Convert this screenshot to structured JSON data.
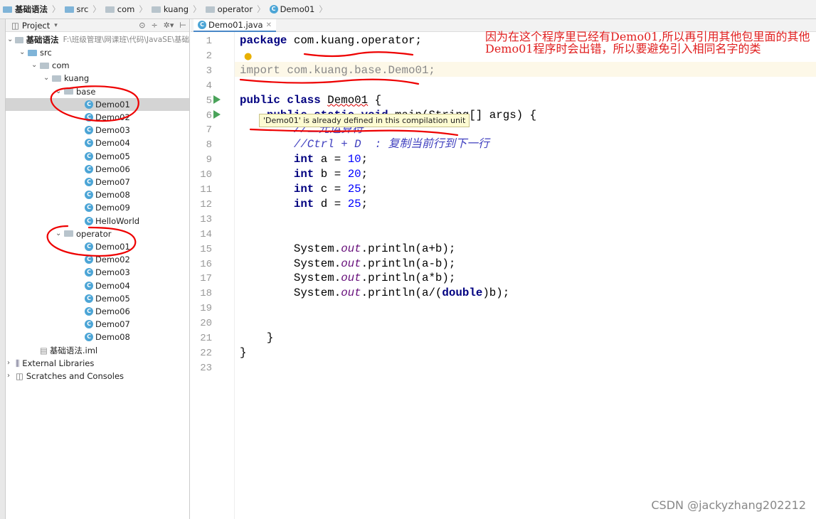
{
  "breadcrumb": [
    "基础语法",
    "src",
    "com",
    "kuang",
    "operator",
    "Demo01"
  ],
  "sidebar": {
    "title": "Project",
    "root": {
      "label": "基础语法",
      "path": "F:\\班级管理\\网课班\\代码\\JavaSE\\基础"
    },
    "tree": [
      {
        "label": "src",
        "depth": 1,
        "type": "folder-blue",
        "expanded": true
      },
      {
        "label": "com",
        "depth": 2,
        "type": "folder",
        "expanded": true
      },
      {
        "label": "kuang",
        "depth": 3,
        "type": "folder",
        "expanded": true
      },
      {
        "label": "base",
        "depth": 4,
        "type": "folder",
        "expanded": true
      },
      {
        "label": "Demo01",
        "depth": 5,
        "type": "class",
        "selected": true
      },
      {
        "label": "Demo02",
        "depth": 5,
        "type": "class"
      },
      {
        "label": "Demo03",
        "depth": 5,
        "type": "class"
      },
      {
        "label": "Demo04",
        "depth": 5,
        "type": "class"
      },
      {
        "label": "Demo05",
        "depth": 5,
        "type": "class"
      },
      {
        "label": "Demo06",
        "depth": 5,
        "type": "class"
      },
      {
        "label": "Demo07",
        "depth": 5,
        "type": "class"
      },
      {
        "label": "Demo08",
        "depth": 5,
        "type": "class"
      },
      {
        "label": "Demo09",
        "depth": 5,
        "type": "class"
      },
      {
        "label": "HelloWorld",
        "depth": 5,
        "type": "class"
      },
      {
        "label": "operator",
        "depth": 4,
        "type": "folder",
        "expanded": true
      },
      {
        "label": "Demo01",
        "depth": 5,
        "type": "class"
      },
      {
        "label": "Demo02",
        "depth": 5,
        "type": "class"
      },
      {
        "label": "Demo03",
        "depth": 5,
        "type": "class"
      },
      {
        "label": "Demo04",
        "depth": 5,
        "type": "class"
      },
      {
        "label": "Demo05",
        "depth": 5,
        "type": "class"
      },
      {
        "label": "Demo06",
        "depth": 5,
        "type": "class"
      },
      {
        "label": "Demo07",
        "depth": 5,
        "type": "class"
      },
      {
        "label": "Demo08",
        "depth": 5,
        "type": "class"
      },
      {
        "label": "基础语法.iml",
        "depth": 2,
        "type": "file"
      },
      {
        "label": "External Libraries",
        "depth": 0,
        "type": "lib",
        "expanded": false
      },
      {
        "label": "Scratches and Consoles",
        "depth": 0,
        "type": "scratch",
        "expanded": false
      }
    ]
  },
  "editor": {
    "tab": "Demo01.java",
    "current_line": 3,
    "lines": [
      [
        [
          "package",
          "kw"
        ],
        [
          " com.kuang.operator;",
          ""
        ]
      ],
      [],
      [
        [
          "import com.kuang.base.Demo01;",
          "unused"
        ]
      ],
      [],
      [
        [
          "public class",
          "kw"
        ],
        [
          " ",
          ""
        ],
        [
          "Demo01",
          "err"
        ],
        [
          " {",
          ""
        ]
      ],
      [
        [
          "    ",
          ""
        ],
        [
          "public static void",
          "kw"
        ],
        [
          " main(String[] args) {",
          ""
        ]
      ],
      [
        [
          "        //二元运算符",
          "cm"
        ]
      ],
      [
        [
          "        //Ctrl + D  : 复制当前行到下一行",
          "cm"
        ]
      ],
      [
        [
          "        ",
          ""
        ],
        [
          "int",
          "kw"
        ],
        [
          " a = ",
          ""
        ],
        [
          "10",
          "num"
        ],
        [
          ";",
          ""
        ]
      ],
      [
        [
          "        ",
          ""
        ],
        [
          "int",
          "kw"
        ],
        [
          " b = ",
          ""
        ],
        [
          "20",
          "num"
        ],
        [
          ";",
          ""
        ]
      ],
      [
        [
          "        ",
          ""
        ],
        [
          "int",
          "kw"
        ],
        [
          " c = ",
          ""
        ],
        [
          "25",
          "num"
        ],
        [
          ";",
          ""
        ]
      ],
      [
        [
          "        ",
          ""
        ],
        [
          "int",
          "kw"
        ],
        [
          " d = ",
          ""
        ],
        [
          "25",
          "num"
        ],
        [
          ";",
          ""
        ]
      ],
      [],
      [],
      [
        [
          "        System.",
          ""
        ],
        [
          "out",
          "fld"
        ],
        [
          ".println(a+b);",
          ""
        ]
      ],
      [
        [
          "        System.",
          ""
        ],
        [
          "out",
          "fld"
        ],
        [
          ".println(a-b);",
          ""
        ]
      ],
      [
        [
          "        System.",
          ""
        ],
        [
          "out",
          "fld"
        ],
        [
          ".println(a*b);",
          ""
        ]
      ],
      [
        [
          "        System.",
          ""
        ],
        [
          "out",
          "fld"
        ],
        [
          ".println(a/(",
          ""
        ],
        [
          "double",
          "kw"
        ],
        [
          ")b);",
          ""
        ]
      ],
      [],
      [],
      [
        [
          "    }",
          ""
        ]
      ],
      [
        [
          "}",
          ""
        ]
      ],
      []
    ],
    "tooltip": "'Demo01' is already defined in this compilation unit"
  },
  "annotation": "因为在这个程序里已经有Demo01,所以再引用其他包里面的其他Demo01程序时会出错，所以要避免引入相同名字的类",
  "watermark": "CSDN @jackyzhang202212",
  "colors": {
    "annotation": "#e02020",
    "keyword": "#000080",
    "number": "#0000ff",
    "selection": "#d4d4d4"
  }
}
